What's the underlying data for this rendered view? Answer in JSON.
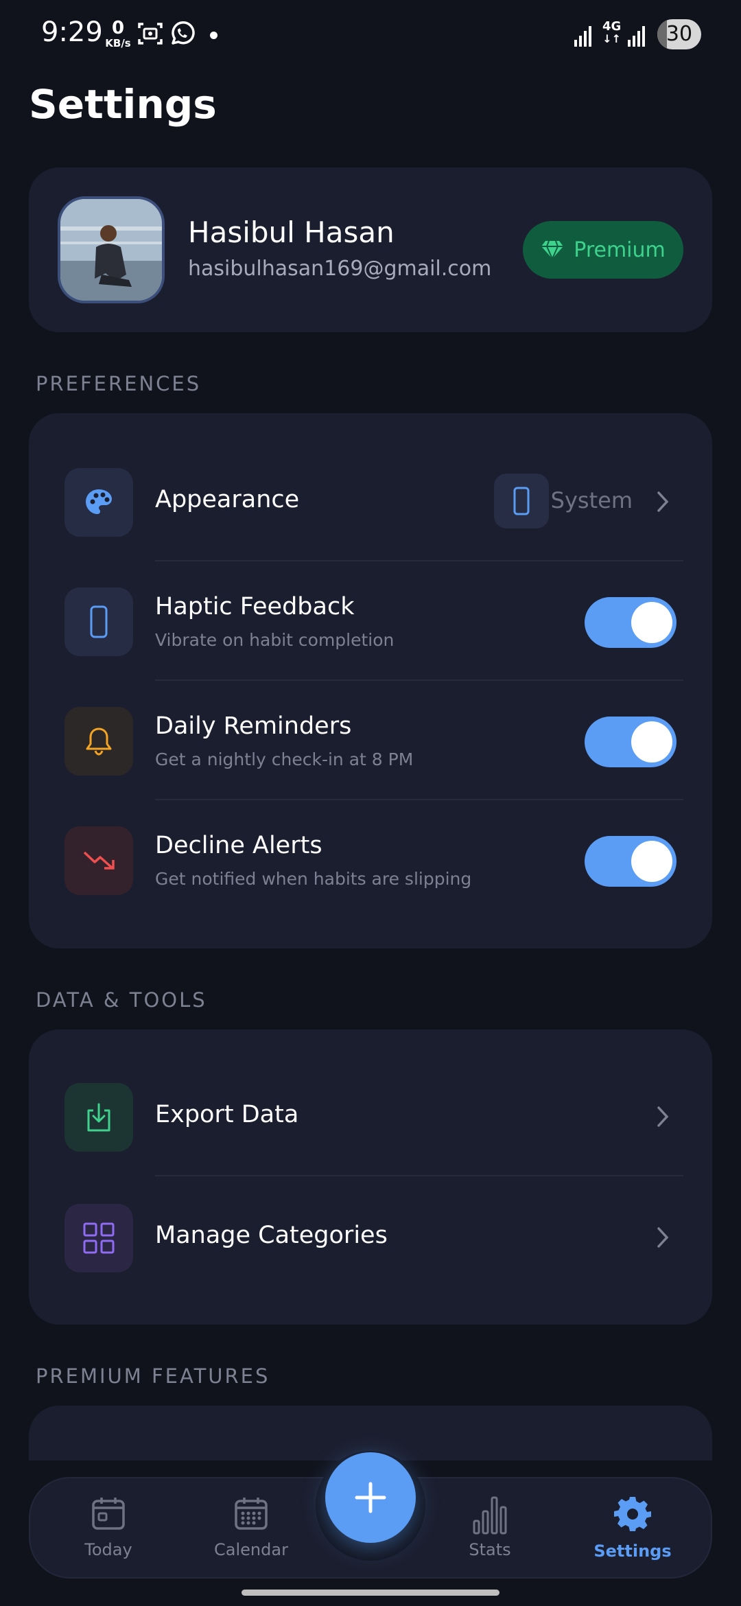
{
  "status_bar": {
    "time": "9:29",
    "net_speed_value": "0",
    "net_speed_unit": "KB/s",
    "network_type": "4G",
    "battery": "30"
  },
  "page": {
    "title": "Settings"
  },
  "profile": {
    "name": "Hasibul Hasan",
    "email": "hasibulhasan169@gmail.com",
    "premium_label": "Premium"
  },
  "preferences": {
    "section_label": "PREFERENCES",
    "items": [
      {
        "title": "Appearance",
        "value": "System",
        "icon": "palette-icon"
      },
      {
        "title": "Haptic Feedback",
        "subtitle": "Vibrate on habit completion",
        "enabled": true,
        "icon": "phone-icon"
      },
      {
        "title": "Daily Reminders",
        "subtitle": "Get a nightly check-in at 8 PM",
        "enabled": true,
        "icon": "bell-icon"
      },
      {
        "title": "Decline Alerts",
        "subtitle": "Get notified when habits are slipping",
        "enabled": true,
        "icon": "trending-down-icon"
      }
    ]
  },
  "data_tools": {
    "section_label": "DATA & TOOLS",
    "items": [
      {
        "title": "Export Data",
        "icon": "download-icon"
      },
      {
        "title": "Manage Categories",
        "icon": "grid-icon"
      }
    ]
  },
  "premium_features": {
    "section_label": "PREMIUM FEATURES"
  },
  "nav": {
    "items": [
      {
        "label": "Today",
        "icon": "today-icon"
      },
      {
        "label": "Calendar",
        "icon": "calendar-icon"
      },
      {
        "label": "Stats",
        "icon": "stats-icon"
      },
      {
        "label": "Settings",
        "icon": "gear-icon",
        "active": true
      }
    ]
  },
  "colors": {
    "background": "#11131c",
    "card": "#1b1e2e",
    "accent": "#5b9cf4",
    "premium_bg": "#0f5d3e",
    "premium_text": "#3fd28d",
    "muted_text": "#7d8192"
  }
}
